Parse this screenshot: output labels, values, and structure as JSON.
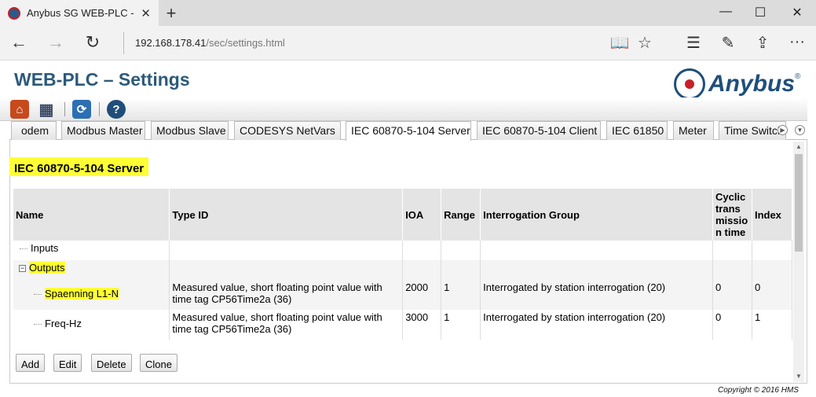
{
  "browser": {
    "tab_title": "Anybus SG WEB-PLC - S",
    "tab_close": "✕",
    "new_tab": "+",
    "url_host": "192.168.178.41",
    "url_path": "/sec/settings.html",
    "window_controls": {
      "minimize": "—",
      "maximize": "☐",
      "close": "✕"
    },
    "nav": {
      "back": "←",
      "forward": "→",
      "refresh": "↻"
    },
    "toolbar_icons": {
      "reading": "📖",
      "favorite": "☆",
      "hub": "☰",
      "notes": "✎",
      "share": "⇪",
      "more": "···"
    }
  },
  "page": {
    "title": "WEB-PLC – Settings",
    "brand": "Anybus",
    "brand_reg": "®",
    "toolbar": {
      "home": "⌂",
      "grid": "▦",
      "refresh": "⟳",
      "help": "?"
    },
    "tab_prev": "◀",
    "tab_next": "▶",
    "tab_menu": "▼",
    "tabs": [
      {
        "label": "odem"
      },
      {
        "label": "Modbus Master"
      },
      {
        "label": "Modbus Slave"
      },
      {
        "label": "CODESYS NetVars"
      },
      {
        "label": "IEC 60870-5-104 Server"
      },
      {
        "label": "IEC 60870-5-104 Client"
      },
      {
        "label": "IEC 61850"
      },
      {
        "label": "Meter"
      },
      {
        "label": "Time Switch"
      }
    ],
    "section_title": "IEC 60870-5-104 Server",
    "table": {
      "headers": {
        "name": "Name",
        "type_id": "Type ID",
        "ioa": "IOA",
        "range": "Range",
        "group": "Interrogation Group",
        "cyclic_1": "Cyclic",
        "cyclic_2": "trans",
        "cyclic_3": "missio",
        "cyclic_4": "n time",
        "index": "Index"
      },
      "rows": [
        {
          "name": "Inputs"
        },
        {
          "name": "Outputs",
          "expander": "−"
        },
        {
          "name": "Spaenning L1-N",
          "type_line1": "Measured value, short floating point value with",
          "type_line2": "time tag CP56Time2a (36)",
          "ioa": "2000",
          "range": "1",
          "group": "Interrogated by station interrogation (20)",
          "cyclic": "0",
          "index": "0"
        },
        {
          "name": "Freq-Hz",
          "type_line1": "Measured value, short floating point value with",
          "type_line2": "time tag CP56Time2a (36)",
          "ioa": "3000",
          "range": "1",
          "group": "Interrogated by station interrogation (20)",
          "cyclic": "0",
          "index": "1"
        }
      ]
    },
    "buttons": {
      "add": "Add",
      "edit": "Edit",
      "delete": "Delete",
      "clone": "Clone"
    },
    "scroll_up": "▲",
    "scroll_down": "▼",
    "copyright": "Copyright © 2016 HMS"
  }
}
